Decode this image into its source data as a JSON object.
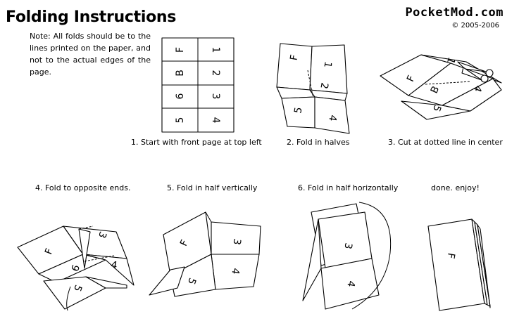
{
  "header": {
    "title": "Folding Instructions",
    "note": "Note: All folds should be to the lines printed on the paper, and not to the actual edges of the page.",
    "brand": "PocketMod.com",
    "copyright": "© 2005-2006"
  },
  "steps": [
    {
      "caption": "1. Start with front page at top left"
    },
    {
      "caption": "2. Fold in halves"
    },
    {
      "caption": "3. Cut at dotted line in center"
    },
    {
      "caption": "4. Fold to opposite ends."
    },
    {
      "caption": "5. Fold in half vertically"
    },
    {
      "caption": "6. Fold in half horizontally"
    },
    {
      "caption": "done. enjoy!"
    }
  ],
  "page_labels": {
    "grid": [
      "F",
      "1",
      "B",
      "2",
      "6",
      "3",
      "5",
      "4"
    ],
    "front": "F",
    "p1": "1",
    "p2": "2",
    "p3": "3",
    "p4": "4",
    "p5": "5",
    "p6": "6",
    "back": "B"
  }
}
